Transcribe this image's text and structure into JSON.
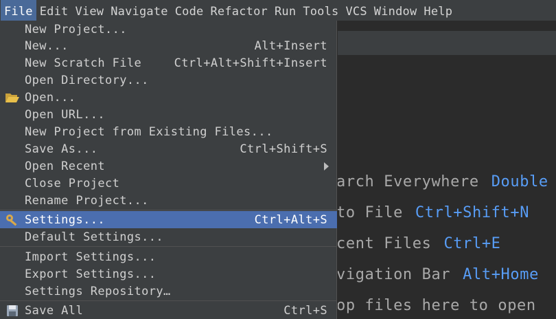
{
  "menubar": {
    "items": [
      {
        "label": "File",
        "active": true
      },
      {
        "label": "Edit"
      },
      {
        "label": "View"
      },
      {
        "label": "Navigate"
      },
      {
        "label": "Code"
      },
      {
        "label": "Refactor"
      },
      {
        "label": "Run"
      },
      {
        "label": "Tools"
      },
      {
        "label": "VCS"
      },
      {
        "label": "Window"
      },
      {
        "label": "Help"
      }
    ]
  },
  "file_menu": {
    "items": [
      {
        "label": "New Project...",
        "shortcut": ""
      },
      {
        "label": "New...",
        "shortcut": "Alt+Insert"
      },
      {
        "label": "New Scratch File",
        "shortcut": "Ctrl+Alt+Shift+Insert"
      },
      {
        "label": "Open Directory...",
        "shortcut": ""
      },
      {
        "label": "Open...",
        "shortcut": "",
        "icon": "folder-open-icon"
      },
      {
        "label": "Open URL...",
        "shortcut": ""
      },
      {
        "label": "New Project from Existing Files...",
        "shortcut": ""
      },
      {
        "label": "Save As...",
        "shortcut": "Ctrl+Shift+S"
      },
      {
        "label": "Open Recent",
        "shortcut": "",
        "submenu": true
      },
      {
        "label": "Close Project",
        "shortcut": ""
      },
      {
        "label": "Rename Project...",
        "shortcut": ""
      },
      {
        "label": "Settings...",
        "shortcut": "Ctrl+Alt+S",
        "icon": "wrench-icon",
        "selected": true
      },
      {
        "label": "Default Settings...",
        "shortcut": ""
      },
      {
        "label": "Import Settings...",
        "shortcut": ""
      },
      {
        "label": "Export Settings...",
        "shortcut": ""
      },
      {
        "label": "Settings Repository…",
        "shortcut": ""
      },
      {
        "label": "Save All",
        "shortcut": "Ctrl+S",
        "icon": "floppy-disk-icon"
      }
    ]
  },
  "editor_hints": [
    {
      "text": "arch Everywhere",
      "key": "Double"
    },
    {
      "text": " to File",
      "key": "Ctrl+Shift+N"
    },
    {
      "text": "cent Files",
      "key": "Ctrl+E"
    },
    {
      "text": "vigation Bar",
      "key": "Alt+Home"
    },
    {
      "text": "op files here to open",
      "key": ""
    }
  ],
  "colors": {
    "menu_bg": "#3c3f41",
    "selection": "#4b6eaf",
    "link_key": "#589df6",
    "editor_bg": "#2b2b2b"
  }
}
